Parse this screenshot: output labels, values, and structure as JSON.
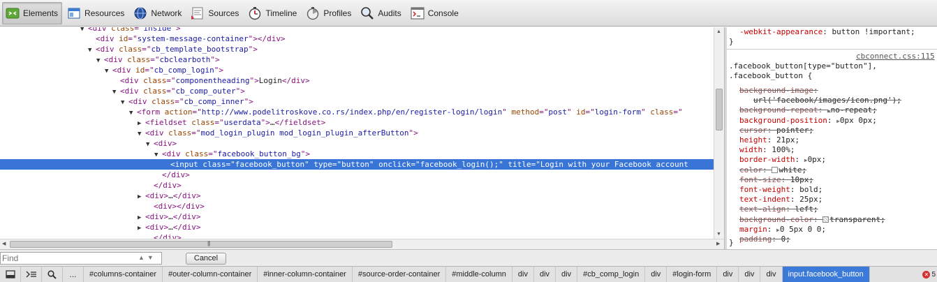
{
  "toolbar": {
    "tabs": [
      {
        "label": "Elements",
        "icon": "elements-icon",
        "active": true
      },
      {
        "label": "Resources",
        "icon": "resources-icon"
      },
      {
        "label": "Network",
        "icon": "network-icon"
      },
      {
        "label": "Sources",
        "icon": "sources-icon"
      },
      {
        "label": "Timeline",
        "icon": "timeline-icon"
      },
      {
        "label": "Profiles",
        "icon": "profiles-icon"
      },
      {
        "label": "Audits",
        "icon": "audits-icon"
      },
      {
        "label": "Console",
        "icon": "console-icon"
      }
    ]
  },
  "dom_tree": {
    "lines": [
      {
        "indent": 126,
        "tri": "▼",
        "parts": [
          [
            "tg",
            "<div "
          ],
          [
            "an",
            "class"
          ],
          [
            "tg",
            "=\""
          ],
          [
            "av",
            "inside"
          ],
          [
            "tg",
            "\">"
          ]
        ]
      },
      {
        "indent": 137,
        "tri": "",
        "parts": [
          [
            "tg",
            "<div "
          ],
          [
            "an",
            "id"
          ],
          [
            "tg",
            "=\""
          ],
          [
            "av",
            "system-message-container"
          ],
          [
            "tg",
            "\"></div>"
          ]
        ]
      },
      {
        "indent": 137,
        "tri": "▼",
        "parts": [
          [
            "tg",
            "<div "
          ],
          [
            "an",
            "class"
          ],
          [
            "tg",
            "=\""
          ],
          [
            "av",
            "cb_template_bootstrap"
          ],
          [
            "tg",
            "\">"
          ]
        ]
      },
      {
        "indent": 149,
        "tri": "▼",
        "parts": [
          [
            "tg",
            "<div "
          ],
          [
            "an",
            "class"
          ],
          [
            "tg",
            "=\""
          ],
          [
            "av",
            "cbclearboth"
          ],
          [
            "tg",
            "\">"
          ]
        ]
      },
      {
        "indent": 161,
        "tri": "▼",
        "parts": [
          [
            "tg",
            "<div "
          ],
          [
            "an",
            "id"
          ],
          [
            "tg",
            "=\""
          ],
          [
            "av",
            "cb_comp_login"
          ],
          [
            "tg",
            "\">"
          ]
        ]
      },
      {
        "indent": 172,
        "tri": "",
        "parts": [
          [
            "tg",
            "<div "
          ],
          [
            "an",
            "class"
          ],
          [
            "tg",
            "=\""
          ],
          [
            "av",
            "componentheading"
          ],
          [
            "tg",
            "\">"
          ],
          [
            "tx",
            "Login"
          ],
          [
            "tg",
            "</div>"
          ]
        ]
      },
      {
        "indent": 172,
        "tri": "▼",
        "parts": [
          [
            "tg",
            "<div "
          ],
          [
            "an",
            "class"
          ],
          [
            "tg",
            "=\""
          ],
          [
            "av",
            "cb_comp_outer"
          ],
          [
            "tg",
            "\">"
          ]
        ]
      },
      {
        "indent": 184,
        "tri": "▼",
        "parts": [
          [
            "tg",
            "<div "
          ],
          [
            "an",
            "class"
          ],
          [
            "tg",
            "=\""
          ],
          [
            "av",
            "cb_comp_inner"
          ],
          [
            "tg",
            "\">"
          ]
        ]
      },
      {
        "indent": 196,
        "tri": "▼",
        "parts": [
          [
            "tg",
            "<form "
          ],
          [
            "an",
            "action"
          ],
          [
            "tg",
            "=\""
          ],
          [
            "av",
            "http://www.podelitroskove.co.rs/index.php/en/register-login/login"
          ],
          [
            "tg",
            "\" "
          ],
          [
            "an",
            "method"
          ],
          [
            "tg",
            "=\""
          ],
          [
            "av",
            "post"
          ],
          [
            "tg",
            "\" "
          ],
          [
            "an",
            "id"
          ],
          [
            "tg",
            "=\""
          ],
          [
            "av",
            "login-form"
          ],
          [
            "tg",
            "\" "
          ],
          [
            "an",
            "class"
          ],
          [
            "tg",
            "=\""
          ]
        ]
      },
      {
        "indent": 208,
        "tri": "▶",
        "parts": [
          [
            "tg",
            "<fieldset "
          ],
          [
            "an",
            "class"
          ],
          [
            "tg",
            "=\""
          ],
          [
            "av",
            "userdata"
          ],
          [
            "tg",
            "\">"
          ],
          [
            "tx",
            "…"
          ],
          [
            "tg",
            "</fieldset>"
          ]
        ]
      },
      {
        "indent": 208,
        "tri": "▼",
        "parts": [
          [
            "tg",
            "<div "
          ],
          [
            "an",
            "class"
          ],
          [
            "tg",
            "=\""
          ],
          [
            "av",
            "mod_login_plugin mod_login_plugin_afterButton"
          ],
          [
            "tg",
            "\">"
          ]
        ]
      },
      {
        "indent": 220,
        "tri": "▼",
        "parts": [
          [
            "tg",
            "<div>"
          ]
        ]
      },
      {
        "indent": 232,
        "tri": "▼",
        "parts": [
          [
            "tg",
            "<div "
          ],
          [
            "an",
            "class"
          ],
          [
            "tg",
            "=\""
          ],
          [
            "av",
            "facebook_button_bg"
          ],
          [
            "tg",
            "\">"
          ]
        ]
      },
      {
        "indent": 244,
        "tri": "",
        "selected": true,
        "parts": [
          [
            "tg",
            "<input "
          ],
          [
            "an",
            "class"
          ],
          [
            "tg",
            "=\""
          ],
          [
            "av",
            "facebook_button"
          ],
          [
            "tg",
            "\" "
          ],
          [
            "an",
            "type"
          ],
          [
            "tg",
            "=\""
          ],
          [
            "av",
            "button"
          ],
          [
            "tg",
            "\" "
          ],
          [
            "an",
            "onclick"
          ],
          [
            "tg",
            "=\""
          ],
          [
            "av",
            "facebook_login();"
          ],
          [
            "tg",
            "\" "
          ],
          [
            "an",
            "title"
          ],
          [
            "tg",
            "=\""
          ],
          [
            "av",
            "Login with your Facebook account"
          ]
        ]
      },
      {
        "indent": 232,
        "tri": "",
        "parts": [
          [
            "tg",
            "</div>"
          ]
        ]
      },
      {
        "indent": 220,
        "tri": "",
        "parts": [
          [
            "tg",
            "</div>"
          ]
        ]
      },
      {
        "indent": 208,
        "tri": "▶",
        "parts": [
          [
            "tg",
            "<div>"
          ],
          [
            "tx",
            "…"
          ],
          [
            "tg",
            "</div>"
          ]
        ]
      },
      {
        "indent": 220,
        "tri": "",
        "parts": [
          [
            "tg",
            "<div></div>"
          ]
        ]
      },
      {
        "indent": 208,
        "tri": "▶",
        "parts": [
          [
            "tg",
            "<div>"
          ],
          [
            "tx",
            "…"
          ],
          [
            "tg",
            "</div>"
          ]
        ]
      },
      {
        "indent": 208,
        "tri": "▶",
        "parts": [
          [
            "tg",
            "<div>"
          ],
          [
            "tx",
            "…"
          ],
          [
            "tg",
            "</div>"
          ]
        ]
      },
      {
        "indent": 220,
        "tri": "",
        "parts": [
          [
            "tg",
            "</div>"
          ]
        ]
      }
    ]
  },
  "styles": {
    "prev_rule_property": "-webkit-appearance",
    "prev_rule_value": "button !important;",
    "close_brace": "}",
    "source": "cbconnect.css:115",
    "selector_line1": ".facebook_button[type=\"button\"],",
    "selector_line2": ".facebook_button {",
    "properties": [
      {
        "name": "background-image",
        "value": "",
        "struck": true
      },
      {
        "name": "",
        "value": "url('facebook/images/icon.png');",
        "struck": true,
        "indent2": true
      },
      {
        "name": "background-repeat",
        "value": "no-repeat;",
        "struck": true,
        "tri": true
      },
      {
        "name": "background-position",
        "value": "0px 0px;",
        "tri": true
      },
      {
        "name": "cursor",
        "value": "pointer;",
        "struck": true
      },
      {
        "name": "height",
        "value": "21px;"
      },
      {
        "name": "width",
        "value": "100%;"
      },
      {
        "name": "border-width",
        "value": "0px;",
        "tri": true
      },
      {
        "name": "color",
        "value": "white;",
        "struck": true,
        "swatch": "white"
      },
      {
        "name": "font-size",
        "value": "10px;",
        "struck": true
      },
      {
        "name": "font-weight",
        "value": "bold;"
      },
      {
        "name": "text-indent",
        "value": "25px;"
      },
      {
        "name": "text-align",
        "value": "left;",
        "struck": true
      },
      {
        "name": "background-color",
        "value": "transparent;",
        "struck": true,
        "swatch": "transp"
      },
      {
        "name": "margin",
        "value": "0 5px 0 0;",
        "tri": true
      },
      {
        "name": "padding",
        "value": "0;",
        "struck": true
      }
    ],
    "end_brace": "}"
  },
  "findbar": {
    "placeholder": "Find",
    "arrows": "▲▼",
    "cancel_label": "Cancel"
  },
  "statusbar": {
    "ellipsis": "...",
    "crumbs": [
      "#columns-container",
      "#outer-column-container",
      "#inner-column-container",
      "#source-order-container",
      "#middle-column",
      "div",
      "div",
      "div",
      "#cb_comp_login",
      "div",
      "#login-form",
      "div",
      "div",
      "div",
      "input.facebook_button"
    ],
    "error_count": "5"
  }
}
